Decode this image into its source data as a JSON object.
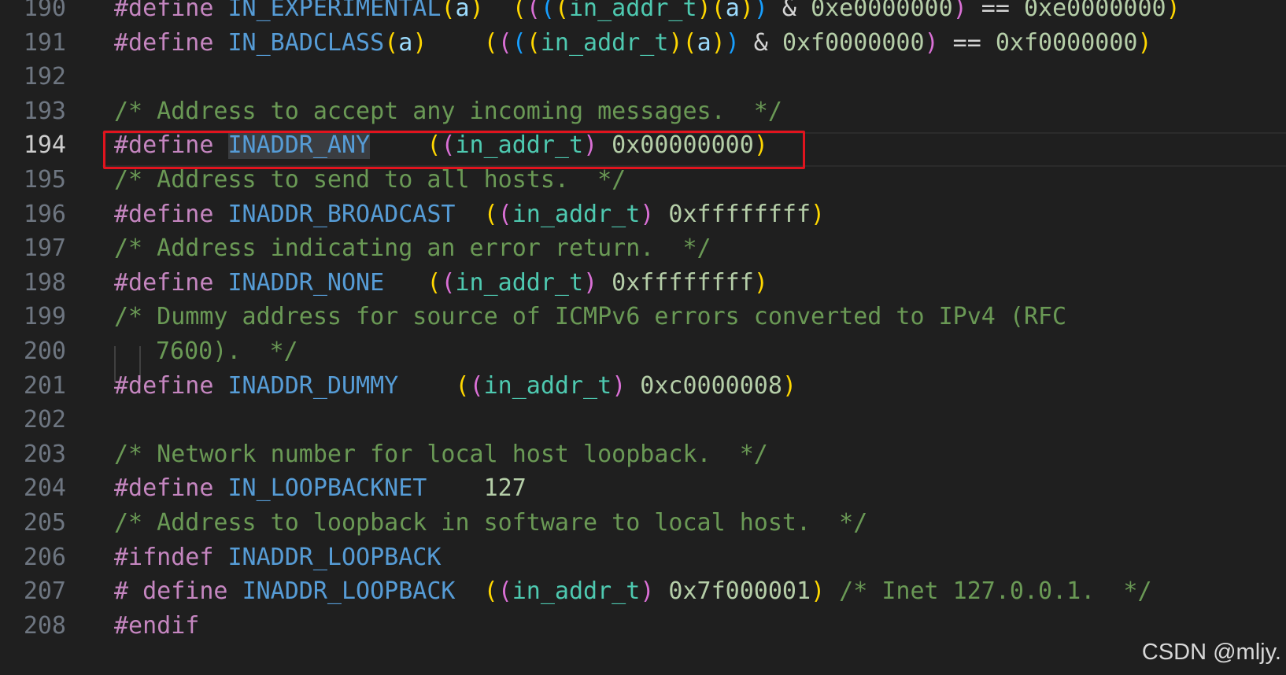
{
  "line_numbers": [
    "190",
    "191",
    "192",
    "193",
    "194",
    "195",
    "196",
    "197",
    "198",
    "199",
    "200",
    "201",
    "202",
    "203",
    "204",
    "205",
    "206",
    "207",
    "208"
  ],
  "active_line": "194",
  "code": {
    "l190": {
      "kw": "#define",
      "name": "IN_EXPERIMENTAL",
      "p1": "(",
      "arg": "a",
      "p2": ")",
      "gap": "  ",
      "o1": "(",
      "o2": "(",
      "o3": "(",
      "o4": "(",
      "type": "in_addr_t",
      "c4": ")",
      "o5": "(",
      "arg2": "a",
      "c5": ")",
      "c3": ")",
      "amp": " & ",
      "mask": "0xe0000000",
      "c2": ")",
      "eq": " == ",
      "val": "0xe0000000",
      "c1": ")"
    },
    "l191": {
      "kw": "#define",
      "name": "IN_BADCLASS",
      "p1": "(",
      "arg": "a",
      "p2": ")",
      "gap": "    ",
      "o1": "(",
      "o2": "(",
      "o3": "(",
      "o4": "(",
      "type": "in_addr_t",
      "c4": ")",
      "o5": "(",
      "arg2": "a",
      "c5": ")",
      "c3": ")",
      "amp": " & ",
      "mask": "0xf0000000",
      "c2": ")",
      "eq": " == ",
      "val": "0xf0000000",
      "c1": ")"
    },
    "l193": {
      "comment": "/* Address to accept any incoming messages.  */"
    },
    "l194": {
      "kw": "#define",
      "name": "INADDR_ANY",
      "gap": "    ",
      "o1": "(",
      "o2": "(",
      "type": "in_addr_t",
      "c2": ")",
      "val": " 0x00000000",
      "c1": ")"
    },
    "l195": {
      "comment": "/* Address to send to all hosts.  */"
    },
    "l196": {
      "kw": "#define",
      "name": "INADDR_BROADCAST",
      "gap": "  ",
      "o1": "(",
      "o2": "(",
      "type": "in_addr_t",
      "c2": ")",
      "val": " 0xffffffff",
      "c1": ")"
    },
    "l197": {
      "comment": "/* Address indicating an error return.  */"
    },
    "l198": {
      "kw": "#define",
      "name": "INADDR_NONE",
      "gap": "   ",
      "o1": "(",
      "o2": "(",
      "type": "in_addr_t",
      "c2": ")",
      "val": " 0xffffffff",
      "c1": ")"
    },
    "l199": {
      "comment": "/* Dummy address for source of ICMPv6 errors converted to IPv4 (RFC"
    },
    "l200": {
      "comment": "7600).  */"
    },
    "l201": {
      "kw": "#define",
      "name": "INADDR_DUMMY",
      "gap": "    ",
      "o1": "(",
      "o2": "(",
      "type": "in_addr_t",
      "c2": ")",
      "val": " 0xc0000008",
      "c1": ")"
    },
    "l203": {
      "comment": "/* Network number for local host loopback.  */"
    },
    "l204": {
      "kw": "#define",
      "name": "IN_LOOPBACKNET",
      "gap": "    ",
      "val": "127"
    },
    "l205": {
      "comment": "/* Address to loopback in software to local host.  */"
    },
    "l206": {
      "kw": "#ifndef",
      "name": "INADDR_LOOPBACK"
    },
    "l207": {
      "kw": "# define",
      "name": "INADDR_LOOPBACK",
      "gap": "  ",
      "o1": "(",
      "o2": "(",
      "type": "in_addr_t",
      "c2": ")",
      "val": " 0x7f000001",
      "c1": ")",
      "comment": " /* Inet 127.0.0.1.  */"
    },
    "l208": {
      "kw": "#endif"
    }
  },
  "watermark": "CSDN @mljy.",
  "colors": {
    "background": "#1f1f1f",
    "keyword": "#c586c0",
    "macro_name": "#569cd6",
    "type": "#4ec9b0",
    "number": "#b5cea8",
    "comment": "#6a9955",
    "bracket_level_1": "#ffd700",
    "bracket_level_2": "#da70d6",
    "bracket_level_3": "#179fff",
    "annotation_box": "#e0141e"
  }
}
